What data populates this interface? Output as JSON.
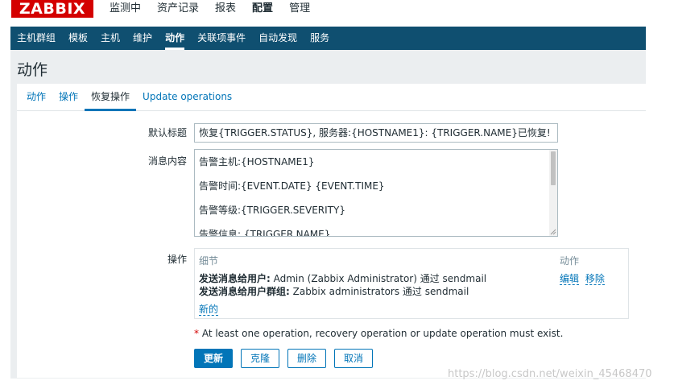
{
  "logo": "ZABBIX",
  "main_menu": [
    {
      "label": "监测中"
    },
    {
      "label": "资产记录"
    },
    {
      "label": "报表"
    },
    {
      "label": "配置",
      "active": true
    },
    {
      "label": "管理"
    }
  ],
  "sub_menu": [
    {
      "label": "主机群组"
    },
    {
      "label": "模板"
    },
    {
      "label": "主机"
    },
    {
      "label": "维护"
    },
    {
      "label": "动作",
      "active": true
    },
    {
      "label": "关联项事件"
    },
    {
      "label": "自动发现"
    },
    {
      "label": "服务"
    }
  ],
  "page_title": "动作",
  "tabs": [
    {
      "label": "动作"
    },
    {
      "label": "操作"
    },
    {
      "label": "恢复操作",
      "active": true
    },
    {
      "label": "Update operations"
    }
  ],
  "form": {
    "subject_label": "默认标题",
    "subject_value": "恢复{TRIGGER.STATUS}, 服务器:{HOSTNAME1}: {TRIGGER.NAME}已恢复!",
    "message_label": "消息内容",
    "message_lines": [
      "告警主机:{HOSTNAME1}",
      "告警时间:{EVENT.DATE} {EVENT.TIME}",
      "告警等级:{TRIGGER.SEVERITY}",
      "告警信息: {TRIGGER.NAME}"
    ],
    "operations_label": "操作",
    "ops_header_details": "细节",
    "ops_header_action": "动作",
    "ops_line1_bold": "发送消息给用户:",
    "ops_line1_text": " Admin (Zabbix Administrator) 通过 sendmail",
    "ops_line2_bold": "发送消息给用户群组:",
    "ops_line2_text": " Zabbix administrators 通过 sendmail",
    "edit_link": "编辑",
    "remove_link": "移除",
    "new_link": "新的",
    "warning_star": "*",
    "warning_text": " At least one operation, recovery operation or update operation must exist."
  },
  "buttons": {
    "update": "更新",
    "clone": "克隆",
    "delete": "删除",
    "cancel": "取消"
  },
  "watermark": "https://blog.csdn.net/weixin_45468470"
}
